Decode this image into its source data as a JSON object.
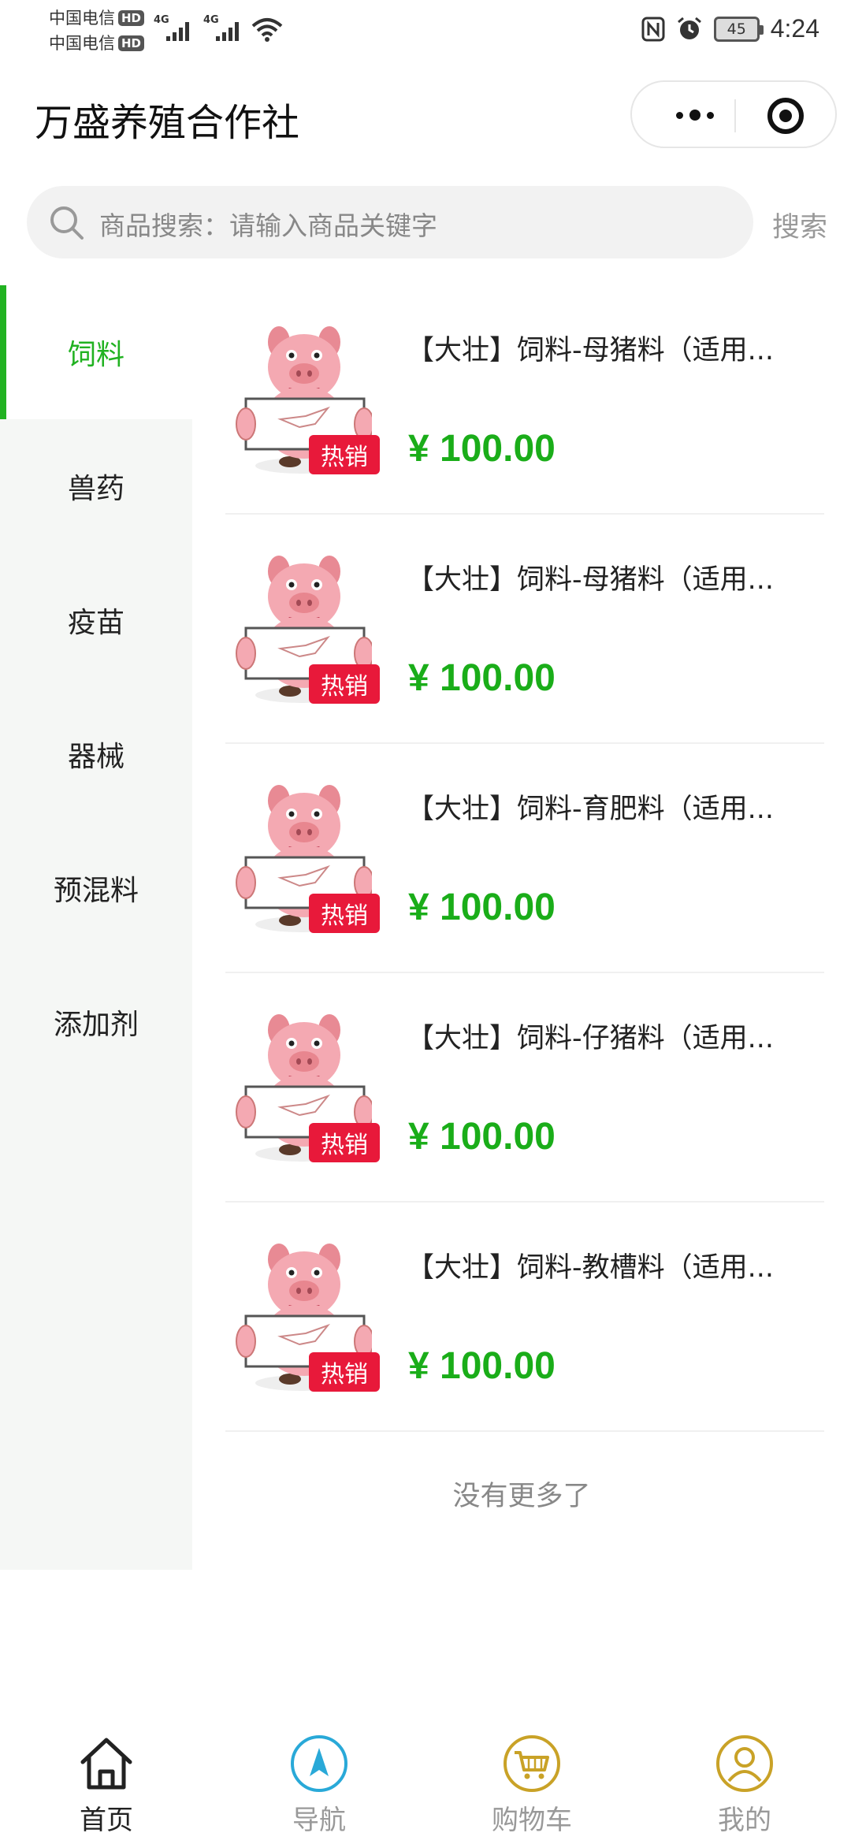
{
  "status_bar": {
    "carriers": [
      "中国电信",
      "中国电信"
    ],
    "hd_badge": "HD",
    "signal_labels": [
      "4G",
      "4G"
    ],
    "battery": "45",
    "time": "4:24"
  },
  "header": {
    "title": "万盛养殖合作社"
  },
  "search": {
    "placeholder": "商品搜索：请输入商品关键字",
    "button_label": "搜索"
  },
  "sidebar": {
    "items": [
      {
        "label": "饲料",
        "active": true
      },
      {
        "label": "兽药"
      },
      {
        "label": "疫苗"
      },
      {
        "label": "器械"
      },
      {
        "label": "预混料"
      },
      {
        "label": "添加剂"
      }
    ]
  },
  "products": [
    {
      "name": "【大壮】饲料-母猪料（适用...",
      "price": "¥ 100.00",
      "badge": "热销"
    },
    {
      "name": "【大壮】饲料-母猪料（适用...",
      "price": "¥ 100.00",
      "badge": "热销"
    },
    {
      "name": "【大壮】饲料-育肥料（适用...",
      "price": "¥ 100.00",
      "badge": "热销"
    },
    {
      "name": "【大壮】饲料-仔猪料（适用...",
      "price": "¥ 100.00",
      "badge": "热销"
    },
    {
      "name": "【大壮】饲料-教槽料（适用...",
      "price": "¥ 100.00",
      "badge": "热销"
    }
  ],
  "list_footer": "没有更多了",
  "tabbar": {
    "items": [
      {
        "label": "首页",
        "icon": "home-icon",
        "active": true
      },
      {
        "label": "导航",
        "icon": "navigation-icon"
      },
      {
        "label": "购物车",
        "icon": "cart-icon"
      },
      {
        "label": "我的",
        "icon": "user-icon"
      }
    ]
  },
  "colors": {
    "accent_green": "#21b221",
    "price_green": "#1aad19",
    "hot_badge_red": "#e8193a",
    "nav_blue": "#29a9d8",
    "gold": "#c9a227"
  }
}
